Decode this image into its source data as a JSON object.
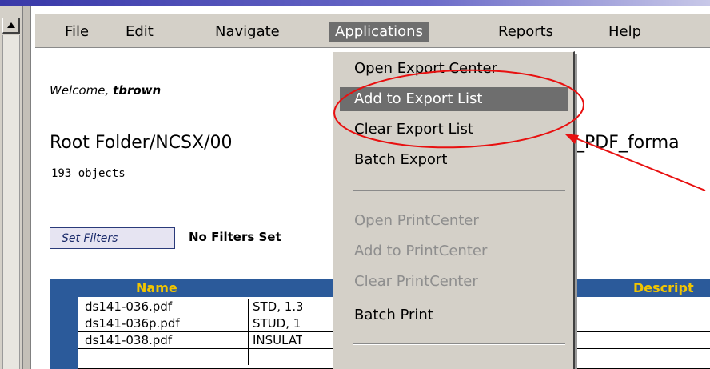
{
  "menubar": {
    "items": [
      "File",
      "Edit",
      "Navigate",
      "Applications",
      "Reports",
      "Help"
    ],
    "active": "Applications"
  },
  "welcome": {
    "prefix": "Welcome, ",
    "user": "tbrown"
  },
  "folder": {
    "path": "Root Folder/NCSX/00",
    "path_tail": "_PDF_forma",
    "object_count": "193 objects"
  },
  "filters": {
    "button_label": "Set Filters",
    "status": "No Filters Set"
  },
  "table": {
    "headers": {
      "name": "Name",
      "description": "Descript"
    },
    "rows": [
      {
        "name": "ds141-036.pdf",
        "col2": "STD, 1.3"
      },
      {
        "name": "ds141-036p.pdf",
        "col2": "STUD, 1"
      },
      {
        "name": "ds141-038.pdf",
        "col2": "INSULAT"
      }
    ]
  },
  "applications_menu": {
    "items": [
      {
        "label": "Open Export Center",
        "state": "enabled"
      },
      {
        "label": "Add to Export List",
        "state": "highlighted"
      },
      {
        "label": "Clear Export List",
        "state": "enabled"
      },
      {
        "label": "Batch Export",
        "state": "enabled"
      },
      {
        "label": "Open PrintCenter",
        "state": "disabled"
      },
      {
        "label": "Add to PrintCenter",
        "state": "disabled"
      },
      {
        "label": "Clear PrintCenter",
        "state": "disabled"
      },
      {
        "label": "Batch Print",
        "state": "enabled"
      }
    ]
  },
  "annotation": {
    "ellipse_color": "#e81010",
    "arrow_color": "#e81010"
  },
  "colors": {
    "table_header": "#2b5a9a",
    "header_text": "#f2c500",
    "menu_highlight": "#6e6e6e"
  }
}
